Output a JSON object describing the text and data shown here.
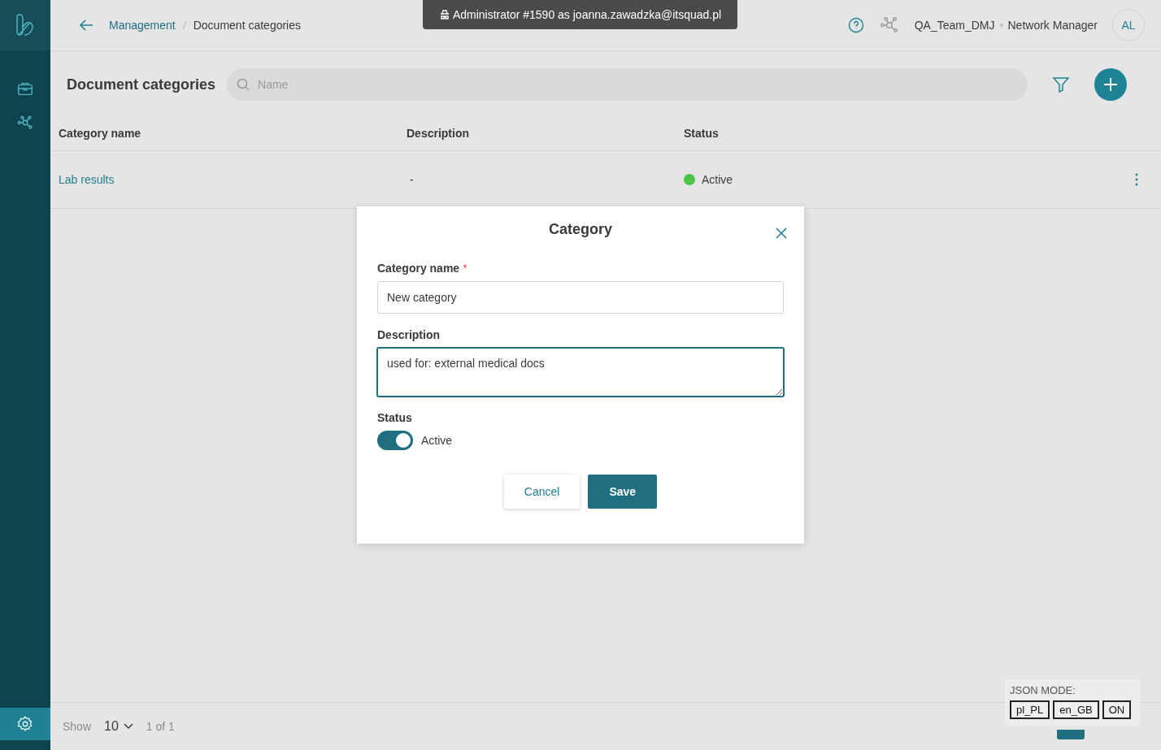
{
  "impersonation_banner": "Administrator #1590 as joanna.zawadzka@itsquad.pl",
  "sidebar": {
    "items": [
      {
        "kind": "briefcase",
        "selected": false
      },
      {
        "kind": "network",
        "selected": false
      },
      {
        "kind": "settings",
        "selected": true
      }
    ]
  },
  "breadcrumb": [
    "Management",
    "Document categories"
  ],
  "header": {
    "team": "QA_Team_DMJ",
    "role": "Network Manager",
    "avatar": "AL"
  },
  "page_title": "Document categories",
  "search": {
    "placeholder": "Name"
  },
  "table": {
    "columns": [
      "Category name",
      "Description",
      "Status"
    ],
    "rows": [
      {
        "name": "Lab results",
        "description": "-",
        "status": "Active",
        "color": "#4bc447"
      }
    ]
  },
  "pagination": {
    "label": "Show",
    "page_size": "10",
    "pages": "1 of 1"
  },
  "dialog": {
    "title": "Category",
    "fields": [
      {
        "kind": "input",
        "label": "Category name",
        "required_mark": "*",
        "value": "New category",
        "focused": false
      },
      {
        "kind": "textarea",
        "label": "Description",
        "value": "used for: external medical docs",
        "focused": true
      }
    ],
    "status": {
      "label": "Status",
      "on": true,
      "text": "Active"
    },
    "buttons": [
      {
        "kind": "secondary",
        "label": "Cancel"
      },
      {
        "kind": "primary",
        "label": "Save"
      }
    ]
  },
  "json_mode": {
    "label": "JSON MODE:",
    "buttons": [
      "pl_PL",
      "en_GB",
      "ON"
    ]
  }
}
